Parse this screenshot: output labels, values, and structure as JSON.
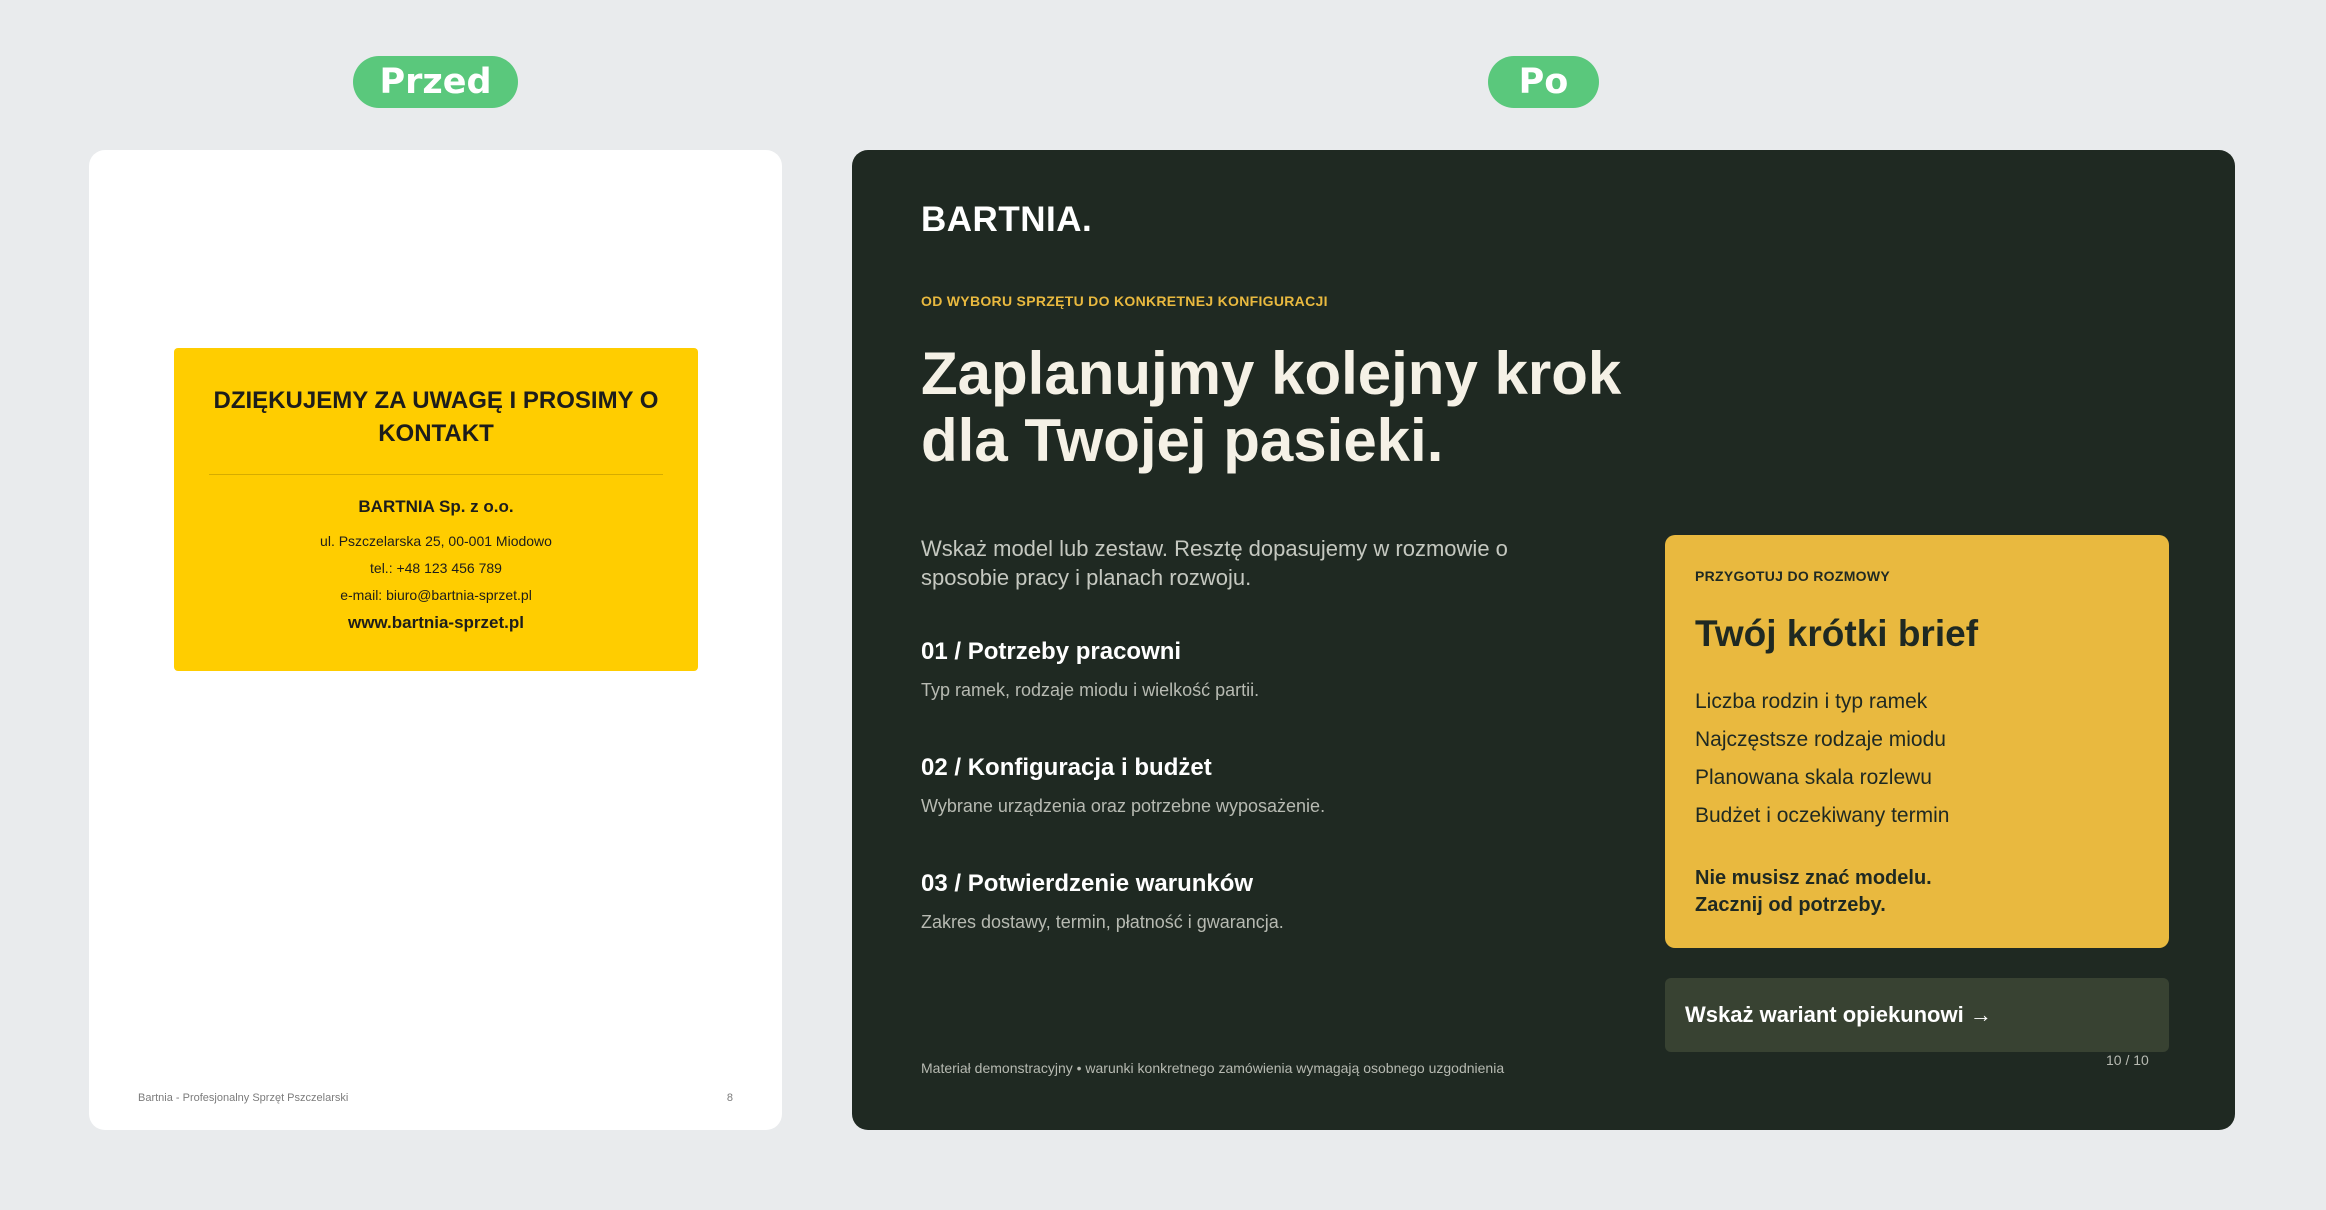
{
  "labels": {
    "before": "Przed",
    "after": "Po"
  },
  "before": {
    "title": "DZIĘKUJEMY ZA UWAGĘ I PROSIMY O KONTAKT",
    "company": "BARTNIA Sp. z o.o.",
    "address": "ul. Pszczelarska 25, 00-001 Miodowo",
    "phone": "tel.: +48 123 456 789",
    "email": "e-mail: biuro@bartnia-sprzet.pl",
    "website": "www.bartnia-sprzet.pl",
    "footer_left": "Bartnia - Profesjonalny Sprzęt Pszczelarski",
    "footer_page": "8"
  },
  "after": {
    "logo": "BARTNIA.",
    "eyebrow": "OD WYBORU SPRZĘTU DO KONKRETNEJ KONFIGURACJI",
    "headline": "Zaplanujmy kolejny krok dla Twojej pasieki.",
    "intro": "Wskaż model lub zestaw. Resztę dopasujemy w rozmowie o sposobie pracy i planach rozwoju.",
    "steps": [
      {
        "title": "01 / Potrzeby pracowni",
        "desc": "Typ ramek, rodzaje miodu i wielkość partii."
      },
      {
        "title": "02 / Konfiguracja i budżet",
        "desc": "Wybrane urządzenia oraz potrzebne wyposażenie."
      },
      {
        "title": "03 / Potwierdzenie warunków",
        "desc": "Zakres dostawy, termin, płatność i gwarancja."
      }
    ],
    "brief": {
      "eyebrow": "PRZYGOTUJ DO ROZMOWY",
      "title": "Twój krótki brief",
      "items": [
        "Liczba rodzin i typ ramek",
        "Najczęstsze rodzaje miodu",
        "Planowana skala rozlewu",
        "Budżet i oczekiwany termin"
      ],
      "note_line1": "Nie musisz znać modelu.",
      "note_line2": "Zacznij od potrzeby."
    },
    "cta": "Wskaż wariant opiekunowi →",
    "footer": "Materiał demonstracyjny • warunki konkretnego zamówienia wymagają osobnego uzgodnienia",
    "page": "10 / 10"
  },
  "colors": {
    "pill": "#5ac87c",
    "before_accent": "#ffcd00",
    "after_bg": "#1f2922",
    "after_accent": "#e9b93f",
    "cta_bg": "#384232"
  }
}
